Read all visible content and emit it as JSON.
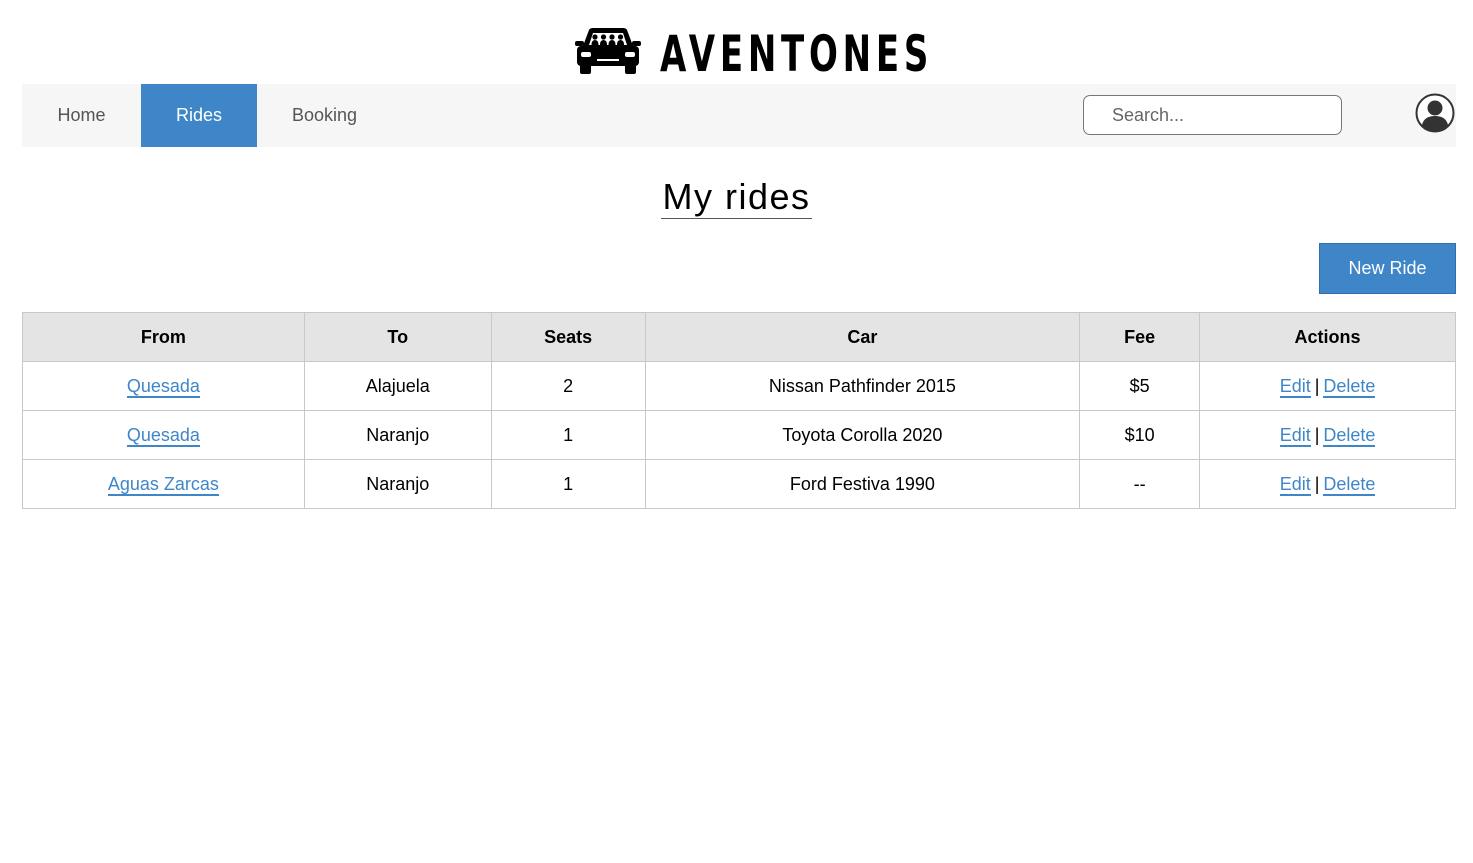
{
  "brand": {
    "name": "AVENTONES",
    "logo_icon": "car-with-passengers-icon"
  },
  "nav": {
    "items": [
      {
        "label": "Home"
      },
      {
        "label": "Rides",
        "active": true
      },
      {
        "label": "Booking"
      }
    ],
    "search_placeholder": "Search...",
    "user_icon": "user-avatar-icon"
  },
  "page": {
    "title": "My rides",
    "new_ride_label": "New Ride"
  },
  "table": {
    "headers": [
      "From",
      "To",
      "Seats",
      "Car",
      "Fee",
      "Actions"
    ],
    "rows": [
      {
        "from": "Quesada",
        "to": "Alajuela",
        "seats": "2",
        "car": "Nissan Pathfinder 2015",
        "fee": "$5",
        "edit": "Edit",
        "delete": "Delete"
      },
      {
        "from": "Quesada",
        "to": "Naranjo",
        "seats": "1",
        "car": "Toyota Corolla 2020",
        "fee": "$10",
        "edit": "Edit",
        "delete": "Delete"
      },
      {
        "from": "Aguas Zarcas",
        "to": "Naranjo",
        "seats": "1",
        "car": "Ford Festiva 1990",
        "fee": "--",
        "edit": "Edit",
        "delete": "Delete"
      }
    ],
    "action_separator": "|"
  },
  "colors": {
    "accent": "#3f86c9",
    "nav_background": "#f6f6f6",
    "table_header_background": "#e4e4e4"
  }
}
